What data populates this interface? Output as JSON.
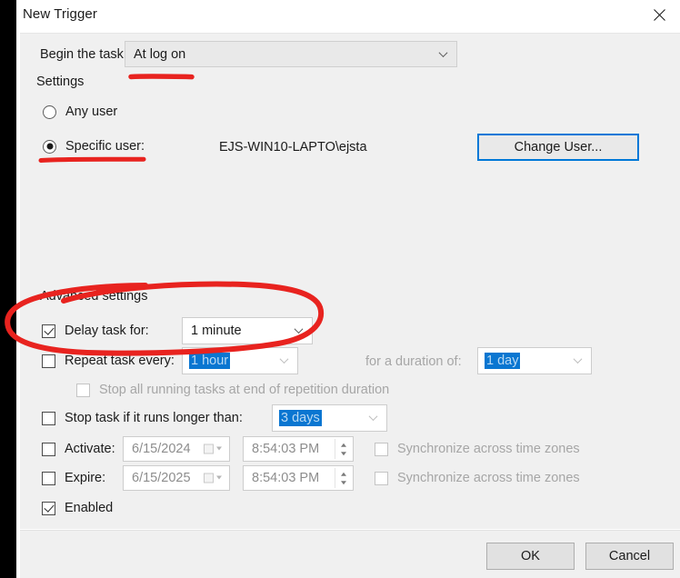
{
  "window": {
    "title": "New Trigger",
    "close_icon": "close-icon"
  },
  "begin_task": {
    "label": "Begin the task:",
    "value": "At log on",
    "chevron_icon": "chevron-down-icon"
  },
  "settings": {
    "group_label": "Settings",
    "any_user": {
      "label": "Any user",
      "checked": false
    },
    "specific_user": {
      "label": "Specific user:",
      "checked": true,
      "value": "EJS-WIN10-LAPTO\\ejsta"
    },
    "change_user_button": "Change User..."
  },
  "advanced": {
    "group_label": "Advanced settings",
    "delay_task": {
      "label": "Delay task for:",
      "checked": true,
      "value": "1 minute"
    },
    "repeat_task": {
      "label": "Repeat task every:",
      "checked": false,
      "value": "1 hour"
    },
    "duration": {
      "label": "for a duration of:",
      "value": "1 day"
    },
    "stop_all_running": {
      "label": "Stop all running tasks at end of repetition duration",
      "checked": false
    },
    "stop_task_longer": {
      "label": "Stop task if it runs longer than:",
      "checked": false,
      "value": "3 days"
    },
    "activate": {
      "label": "Activate:",
      "checked": false,
      "date": "6/15/2024",
      "time": "8:54:03 PM",
      "sync_label": "Synchronize across time zones",
      "sync_checked": false
    },
    "expire": {
      "label": "Expire:",
      "checked": false,
      "date": "6/15/2025",
      "time": "8:54:03 PM",
      "sync_label": "Synchronize across time zones",
      "sync_checked": false
    },
    "enabled": {
      "label": "Enabled",
      "checked": true
    }
  },
  "footer": {
    "ok_label": "OK",
    "cancel_label": "Cancel"
  },
  "annotations": {
    "color": "#e8231f",
    "underline_begin_task": "red underline under Begin the task combo",
    "underline_specific_user": "red underline under Specific user radio",
    "circle_delay_task": "red hand-drawn ellipse around Delay task for row"
  },
  "colors": {
    "accent_blue": "#0078d7",
    "annotation_red": "#e8231f",
    "panel_bg": "#f0f0f0",
    "text": "#1b1b1b",
    "disabled_text": "#a6a6a6"
  }
}
